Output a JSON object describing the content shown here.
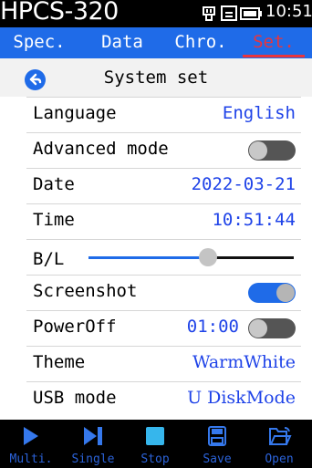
{
  "status": {
    "device": "HPCS-320",
    "time": "10:51",
    "icons": [
      "usb-icon",
      "storage-icon",
      "battery-icon"
    ]
  },
  "tabs": [
    {
      "label": "Spec.",
      "active": false
    },
    {
      "label": "Data",
      "active": false
    },
    {
      "label": "Chro.",
      "active": false
    },
    {
      "label": "Set.",
      "active": true
    }
  ],
  "header": {
    "title": "System set"
  },
  "settings": {
    "language": {
      "label": "Language",
      "value": "English"
    },
    "advanced": {
      "label": "Advanced mode",
      "on": false
    },
    "date": {
      "label": "Date",
      "value": "2022-03-21"
    },
    "time": {
      "label": "Time",
      "value": "10:51:44"
    },
    "backlight": {
      "label": "B/L",
      "level": 0.58
    },
    "screenshot": {
      "label": "Screenshot",
      "on": true
    },
    "poweroff": {
      "label": "PowerOff",
      "value": "01:00",
      "on": false
    },
    "theme": {
      "label": "Theme",
      "value": "WarmWhite"
    },
    "usb": {
      "label": "USB mode",
      "value": "U DiskMode"
    }
  },
  "toolbar": [
    {
      "label": "Multi.",
      "icon": "play-icon"
    },
    {
      "label": "Single",
      "icon": "step-icon"
    },
    {
      "label": "Stop",
      "icon": "stop-icon"
    },
    {
      "label": "Save",
      "icon": "save-icon"
    },
    {
      "label": "Open",
      "icon": "folder-open-icon"
    }
  ],
  "colors": {
    "accent": "#1f6be8",
    "active_tab": "#e8353d",
    "value_text": "#1f43e8",
    "toolbar_label": "#2b62d8"
  }
}
